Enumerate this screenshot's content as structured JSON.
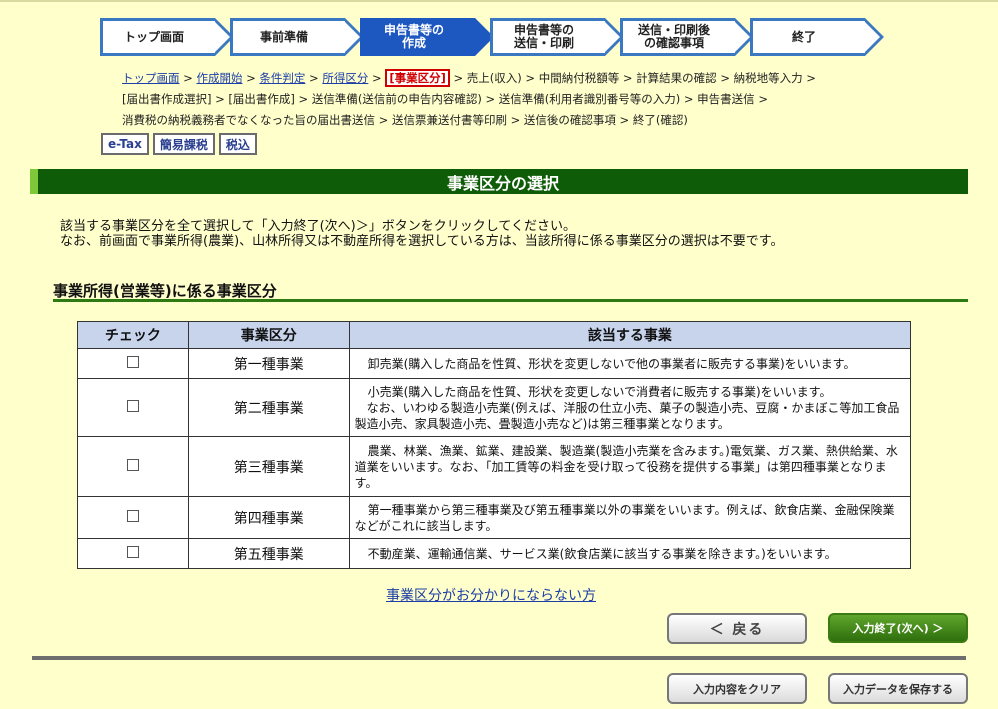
{
  "steps": [
    {
      "label": "トップ画面",
      "active": false
    },
    {
      "label": "事前準備",
      "active": false
    },
    {
      "label": "申告書等の\n作成",
      "active": true
    },
    {
      "label": "申告書等の\n送信・印刷",
      "active": false
    },
    {
      "label": "送信・印刷後\nの確認事項",
      "active": false
    },
    {
      "label": "終了",
      "active": false
    }
  ],
  "breadcrumb": {
    "links": [
      "トップ画面",
      "作成開始",
      "条件判定",
      "所得区分"
    ],
    "current": "[事業区分]",
    "rest1": "売上(収入)",
    "rest2": "中間納付税額等",
    "rest3": "計算結果の確認",
    "rest4": "納税地等入力",
    "line2": "[届出書作成選択] > [届出書作成] > 送信準備(送信前の申告内容確認) > 送信準備(利用者識別番号等の入力) > 申告書送信 >",
    "line3": "消費税の納税義務者でなくなった旨の届出書送信 > 送信票兼送付書等印刷 > 送信後の確認事項 > 終了(確認)"
  },
  "modes": [
    "e-Tax",
    "簡易課税",
    "税込"
  ],
  "title": "事業区分の選択",
  "intro": {
    "line1": "該当する事業区分を全て選択して「入力終了(次へ)＞」ボタンをクリックしてください。",
    "line2": "なお、前画面で事業所得(農業)、山林所得又は不動産所得を選択している方は、当該所得に係る事業区分の選択は不要です。"
  },
  "section_title": "事業所得(営業等)に係る事業区分",
  "table": {
    "headers": [
      "チェック",
      "事業区分",
      "該当する事業"
    ],
    "rows": [
      {
        "kind": "第一種事業",
        "desc": "卸売業(購入した商品を性質、形状を変更しないで他の事業者に販売する事業)をいいます。"
      },
      {
        "kind": "第二種事業",
        "desc": "小売業(購入した商品を性質、形状を変更しないで消費者に販売する事業)をいいます。\n　なお、いわゆる製造小売業(例えば、洋服の仕立小売、菓子の製造小売、豆腐・かまぼこ等加工食品製造小売、家具製造小売、畳製造小売など)は第三種事業となります。"
      },
      {
        "kind": "第三種事業",
        "desc": "農業、林業、漁業、鉱業、建設業、製造業(製造小売業を含みます。)電気業、ガス業、熱供給業、水道業をいいます。なお、「加工賃等の料金を受け取って役務を提供する事業」は第四種事業となります。"
      },
      {
        "kind": "第四種事業",
        "desc": "第一種事業から第三種事業及び第五種事業以外の事業をいいます。例えば、飲食店業、金融保険業などがこれに該当します。"
      },
      {
        "kind": "第五種事業",
        "desc": "不動産業、運輸通信業、サービス業(飲食店業に該当する事業を除きます。)をいいます。"
      }
    ]
  },
  "help_link": "事業区分がお分かりにならない方",
  "buttons": {
    "back": "＜ 戻る",
    "next": "入力終了(次へ) ＞",
    "clear": "入力内容をクリア",
    "save": "入力データを保存する"
  },
  "colors": {
    "page_bg": "#ffffcc",
    "step_border": "#3a78c2",
    "step_active": "#1c58c0",
    "title_bar": "#0f5c08",
    "next_button": "#2e6e0d"
  }
}
